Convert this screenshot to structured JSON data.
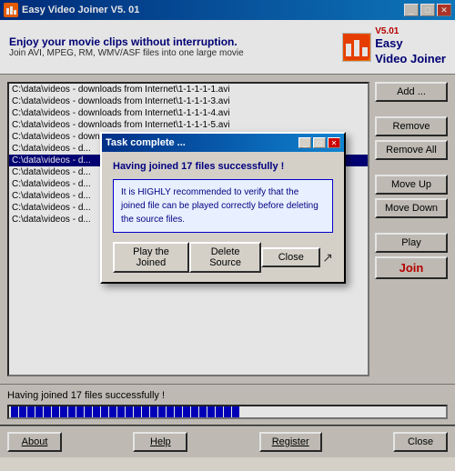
{
  "app": {
    "title": "Easy Video Joiner  V5. 01",
    "version": "V5.01",
    "icon_label": "EV"
  },
  "header": {
    "tagline": "Enjoy your movie clips without interruption.",
    "subtitle": "Join AVI, MPEG, RM, WMV/ASF files into one large movie",
    "logo_line1": "Easy",
    "logo_line2": "Video Joiner",
    "logo_version": "V5.01"
  },
  "file_list": {
    "items": [
      {
        "text": "C:\\data\\videos - downloads from Internet\\1-1-1-1-1.avi",
        "selected": false
      },
      {
        "text": "C:\\data\\videos - downloads from Internet\\1-1-1-1-3.avi",
        "selected": false
      },
      {
        "text": "C:\\data\\videos - downloads from Internet\\1-1-1-1-4.avi",
        "selected": false
      },
      {
        "text": "C:\\data\\videos - downloads from Internet\\1-1-1-1-5.avi",
        "selected": false
      },
      {
        "text": "C:\\data\\videos - downloads from Internet\\1-1-1-1-6.avi",
        "selected": false
      },
      {
        "text": "C:\\data\\videos - d...",
        "selected": false
      },
      {
        "text": "C:\\data\\videos - d...",
        "selected": true
      },
      {
        "text": "C:\\data\\videos - d...",
        "selected": false
      },
      {
        "text": "C:\\data\\videos - d...",
        "selected": false
      },
      {
        "text": "C:\\data\\videos - d...",
        "selected": false
      },
      {
        "text": "C:\\data\\videos - d...",
        "selected": false
      },
      {
        "text": "C:\\data\\videos - d...",
        "selected": false
      }
    ]
  },
  "side_buttons": {
    "add": "Add ...",
    "remove": "Remove",
    "remove_all": "Remove All",
    "move_up": "Move Up",
    "move_down": "Move Down",
    "play": "Play",
    "join": "Join"
  },
  "status": {
    "text": "Having joined 17 files successfully !",
    "progress_blocks": 28
  },
  "bottom_buttons": {
    "about": "About",
    "help": "Help",
    "register": "Register",
    "close": "Close"
  },
  "modal": {
    "title": "Task complete ...",
    "success_text": "Having joined 17 files successfully !",
    "warning_text": "It is HIGHLY recommended to verify that the joined file can be played correctly before deleting the source files.",
    "btn_play_joined": "Play the Joined",
    "btn_delete_source": "Delete Source",
    "btn_close": "Close"
  },
  "title_controls": {
    "minimize": "_",
    "maximize": "□",
    "close": "✕"
  }
}
